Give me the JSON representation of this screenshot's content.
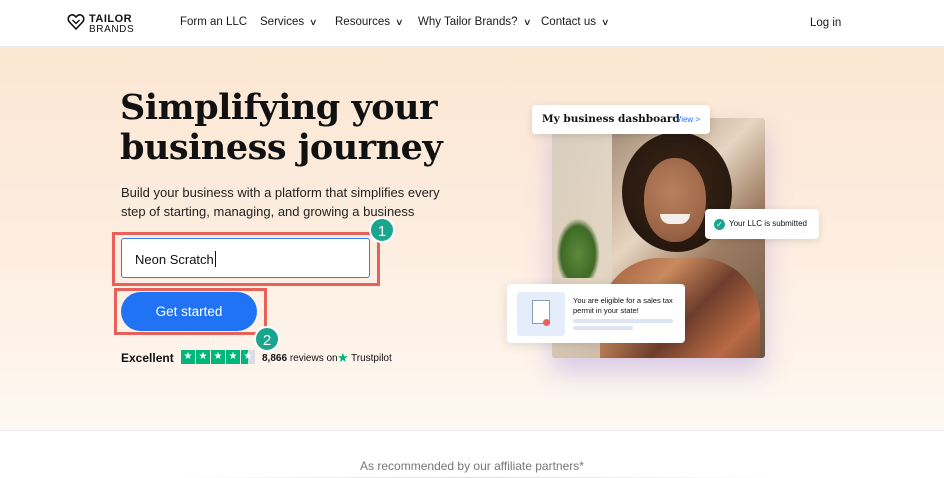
{
  "nav": {
    "logo_line1": "TAILOR",
    "logo_line2": "BRANDS",
    "items": [
      {
        "label": "Form an LLC"
      },
      {
        "label": "Services"
      },
      {
        "label": "Resources"
      },
      {
        "label": "Why Tailor Brands?"
      },
      {
        "label": "Contact us"
      }
    ],
    "login": "Log in"
  },
  "hero": {
    "headline": "Simplifying your business journey",
    "subtext": "Build your business with a platform that simplifies every step of starting, managing, and growing a business",
    "input_value": "Neon Scratch",
    "cta": "Get started",
    "annotation_1": "1",
    "annotation_2": "2"
  },
  "trust": {
    "rating": "Excellent",
    "reviews_count": "8,866",
    "reviews_text": "reviews on",
    "brand": "Trustpilot",
    "stars": 4.5
  },
  "cards": {
    "dashboard_title": "My business dashboard",
    "dashboard_link": "View >",
    "llc_status": "Your LLC is submitted",
    "tax_text": "You are eligible for a sales tax permit in your state!"
  },
  "partners": {
    "text": "As recommended by our affiliate partners*"
  },
  "colors": {
    "accent": "#2173f5",
    "annotation": "#e8605a",
    "badge": "#19a68c",
    "trustpilot": "#00b67a"
  }
}
